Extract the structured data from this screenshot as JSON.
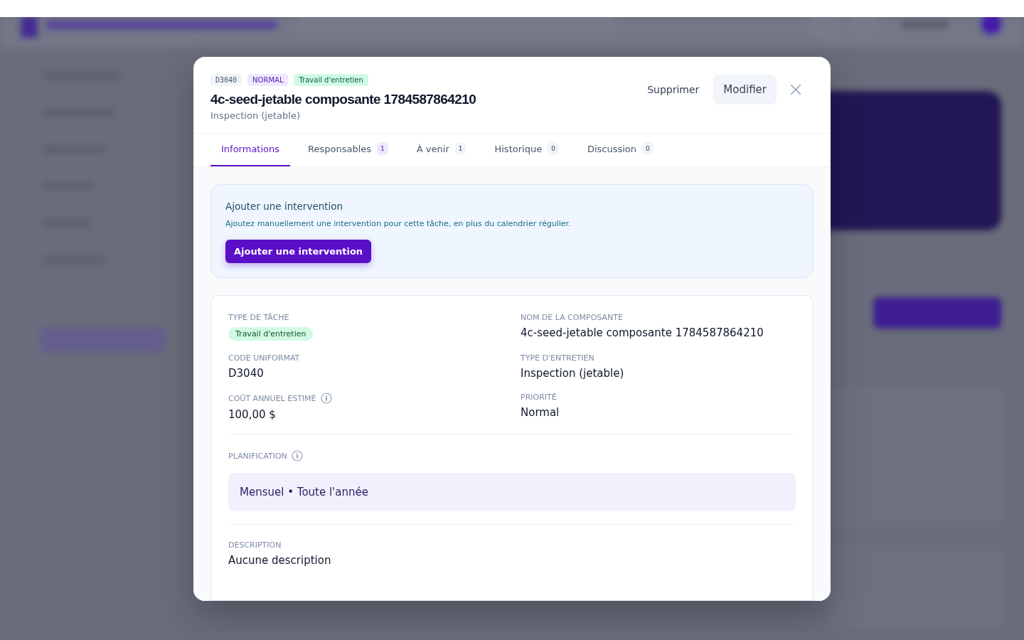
{
  "modal": {
    "badges": [
      {
        "kind": "code",
        "text": "D3040"
      },
      {
        "kind": "priority",
        "text": "NORMAL"
      },
      {
        "kind": "type",
        "text": "Travail d'entretien"
      }
    ],
    "title": "4c-seed-jetable composante 1784587864210",
    "subtitle": "Inspection (jetable)",
    "actions": {
      "delete": "Supprimer",
      "edit": "Modifier"
    },
    "tabs": [
      {
        "label": "Informations",
        "selected": true
      },
      {
        "label": "Responsables",
        "count": "1",
        "highlighted": true,
        "selected": false
      },
      {
        "label": "À venir",
        "count": "1",
        "highlighted": false,
        "selected": false
      },
      {
        "label": "Historique",
        "count": "0",
        "highlighted": false,
        "selected": false
      },
      {
        "label": "Discussion",
        "count": "0",
        "highlighted": false,
        "selected": false
      }
    ],
    "add_panel": {
      "title": "Ajouter une intervention",
      "text": "Ajoutez manuellement une intervention pour cette tâche, en plus du calendrier régulier.",
      "button": "Ajouter une intervention"
    },
    "fields": [
      {
        "label": "TYPE DE TÂCHE",
        "value": "Travail d'entretien",
        "kind": "badge",
        "info": false
      },
      {
        "label": "NOM DE LA COMPOSANTE",
        "value": "4c-seed-jetable composante 1784587864210",
        "kind": "text",
        "info": false
      },
      {
        "label": "CODE UNIFORMAT",
        "value": "D3040",
        "kind": "text",
        "info": false
      },
      {
        "label": "TYPE D'ENTRETIEN",
        "value": "Inspection (jetable)",
        "kind": "text",
        "info": false
      },
      {
        "label": "COÛT ANNUEL ESTIMÉ",
        "value": "100,00 $",
        "kind": "text",
        "info": true
      },
      {
        "label": "PRIORITÉ",
        "value": "Normal",
        "kind": "text",
        "info": false
      }
    ],
    "planning": {
      "label": "PLANIFICATION",
      "info": true,
      "value": "Mensuel • Toute l'année"
    },
    "description": {
      "label": "DESCRIPTION",
      "value": "Aucune description"
    }
  }
}
